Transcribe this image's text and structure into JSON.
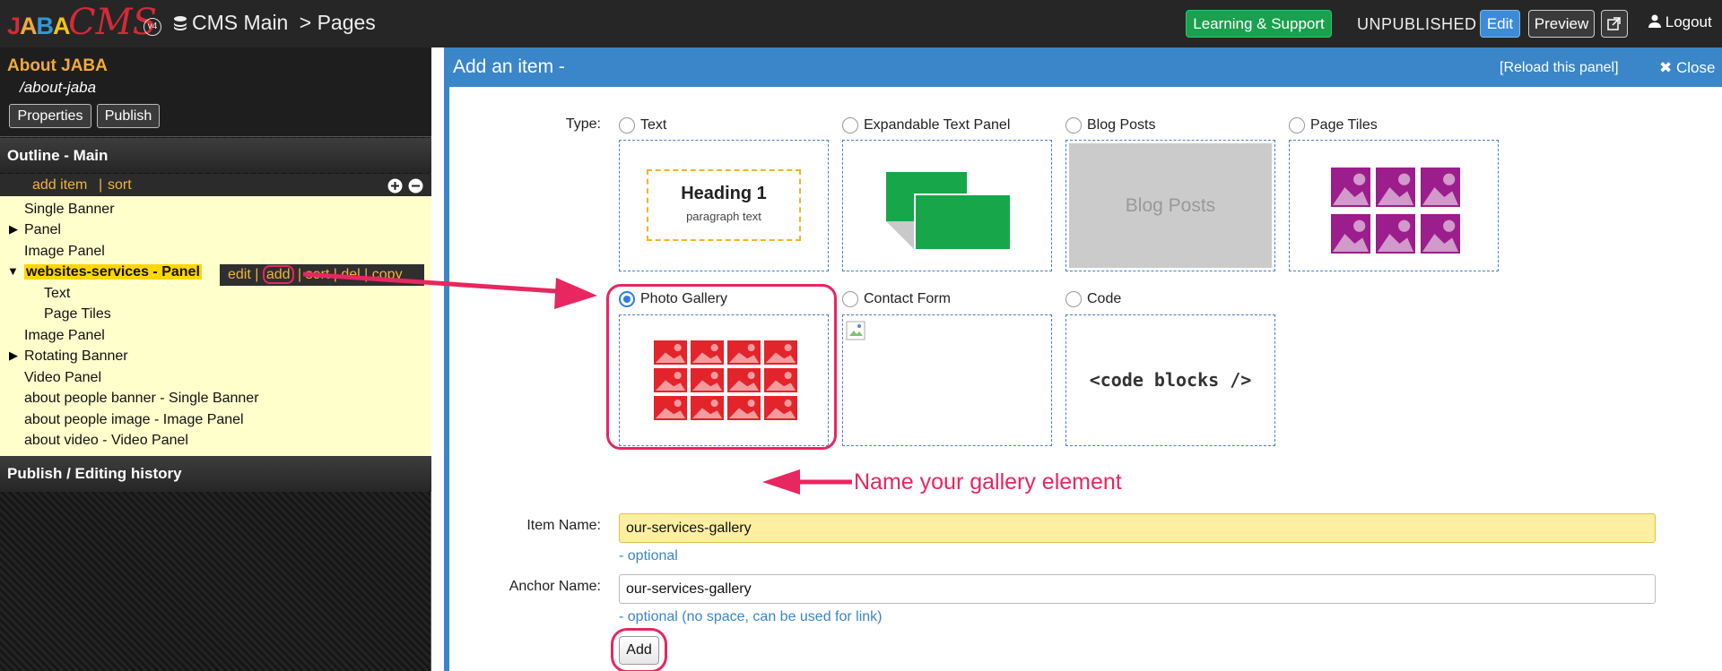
{
  "topbar": {
    "logo_jaba": "JABA",
    "logo_cms": "CMS",
    "logo_version": "v4",
    "breadcrumb_main": "CMS Main",
    "breadcrumb_sep_page": "> Pages",
    "learning_label": "Learning & Support",
    "status": "UNPUBLISHED",
    "edit_label": "Edit",
    "preview_label": "Preview",
    "logout_label": "Logout"
  },
  "sidebar": {
    "page_title": "About JABA",
    "page_slug": "/about-jaba",
    "properties_label": "Properties",
    "publish_label": "Publish",
    "outline_title": "Outline - Main",
    "outline_add_item": "add item",
    "outline_sep": "|",
    "outline_sort": "sort",
    "items": [
      {
        "label": "Single Banner"
      },
      {
        "label": "Panel"
      },
      {
        "label": "Image Panel"
      },
      {
        "label": "websites-services - Panel"
      },
      {
        "label": "Text"
      },
      {
        "label": "Page Tiles"
      },
      {
        "label": "Image Panel"
      },
      {
        "label": "Rotating Banner"
      },
      {
        "label": "Video Panel"
      },
      {
        "label": "about people banner - Single Banner"
      },
      {
        "label": "about people image - Image Panel"
      },
      {
        "label": "about video - Video Panel"
      }
    ],
    "item_tools": {
      "edit": "edit",
      "add": "add",
      "sort": "sort",
      "del": "del",
      "copy": "copy",
      "sep": "|"
    },
    "history_title": "Publish / Editing history"
  },
  "panel": {
    "title": "Add an item -",
    "reload_label": "[Reload this panel]",
    "close_label": "Close",
    "type_label": "Type:",
    "types": [
      {
        "label": "Text",
        "selected": false
      },
      {
        "label": "Expandable Text Panel",
        "selected": false
      },
      {
        "label": "Blog Posts",
        "selected": false
      },
      {
        "label": "Page Tiles",
        "selected": false
      },
      {
        "label": "Photo Gallery",
        "selected": true
      },
      {
        "label": "Contact Form",
        "selected": false
      },
      {
        "label": "Code",
        "selected": false
      }
    ],
    "preview_text": {
      "heading": "Heading 1",
      "paragraph": "paragraph text",
      "blog": "Blog Posts",
      "code": "<code blocks />"
    },
    "item_name_label": "Item Name:",
    "item_name_value": "our-services-gallery",
    "item_name_hint": "- optional",
    "anchor_name_label": "Anchor Name:",
    "anchor_name_value": "our-services-gallery",
    "anchor_name_hint": "- optional (no space, can be used for link)",
    "add_label": "Add"
  },
  "annotation": {
    "text": "Name your gallery element"
  },
  "colors": {
    "accent_blue": "#3a86c8",
    "success_green": "#1aa04e",
    "annotation_pink": "#e8265f",
    "title_orange": "#f2a93b",
    "highlight_yellow": "#ffd600",
    "outline_bg": "#ffffcc",
    "gallery_red": "#e3242b",
    "tiles_purple": "#9c1d8c",
    "panel_green": "#17a649"
  }
}
